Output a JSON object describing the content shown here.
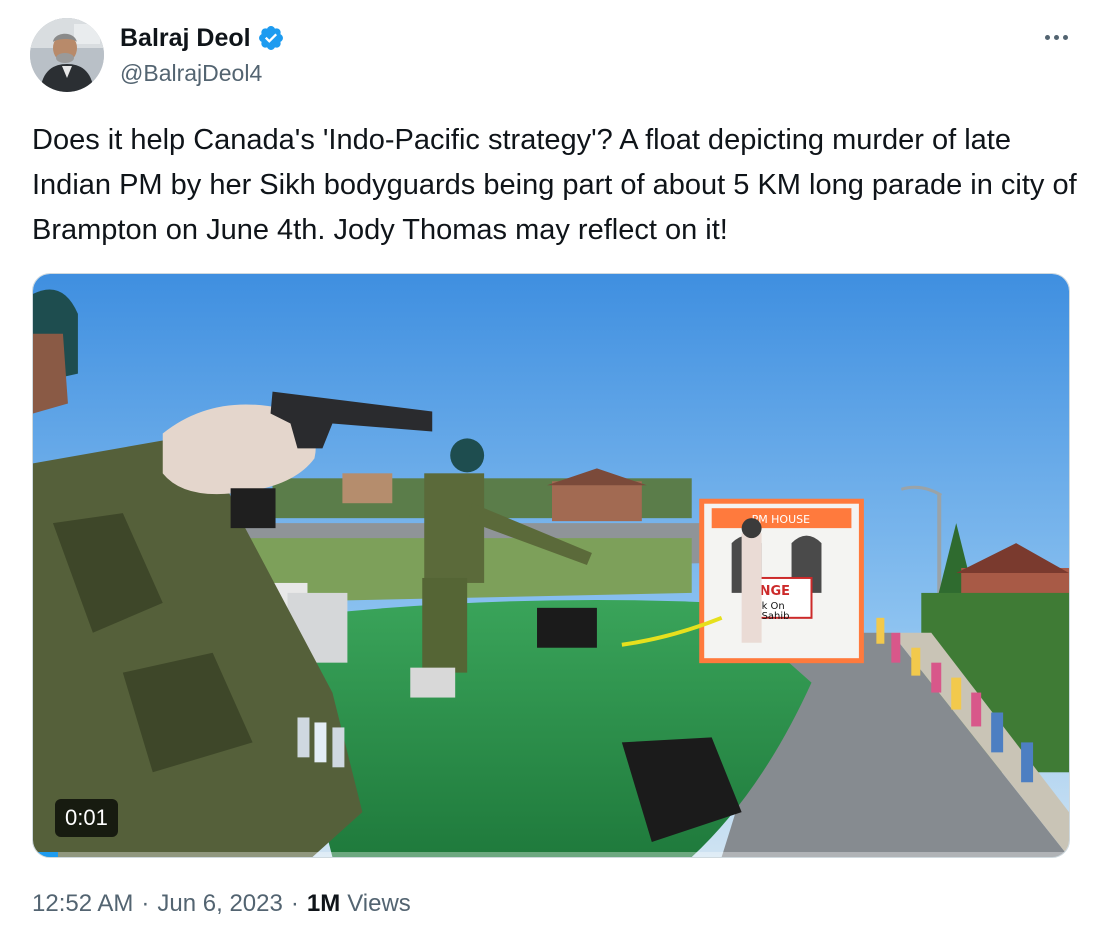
{
  "author": {
    "name": "Balraj Deol",
    "handle": "@BalrajDeol4",
    "verified": true
  },
  "tweet": {
    "text": "Does it help Canada's 'Indo-Pacific strategy'? A float depicting murder of late Indian PM by her Sikh bodyguards being part of about 5 KM long parade in city of Brampton on June 4th. Jody Thomas may reflect on it!"
  },
  "video": {
    "timestamp": "0:01",
    "sign_text_1": "PM HOUSE",
    "sign_text_2": "NGE",
    "sign_text_3": "k On",
    "sign_text_4": "Sahib"
  },
  "meta": {
    "time": "12:52 AM",
    "date": "Jun 6, 2023",
    "views_count": "1M",
    "views_label": "Views",
    "separator": "·"
  },
  "colors": {
    "verified_blue": "#1d9bf0",
    "secondary_text": "#536471",
    "primary_text": "#0f1419"
  },
  "icons": {
    "verified": "verified-badge-icon",
    "more": "more-options-icon"
  }
}
